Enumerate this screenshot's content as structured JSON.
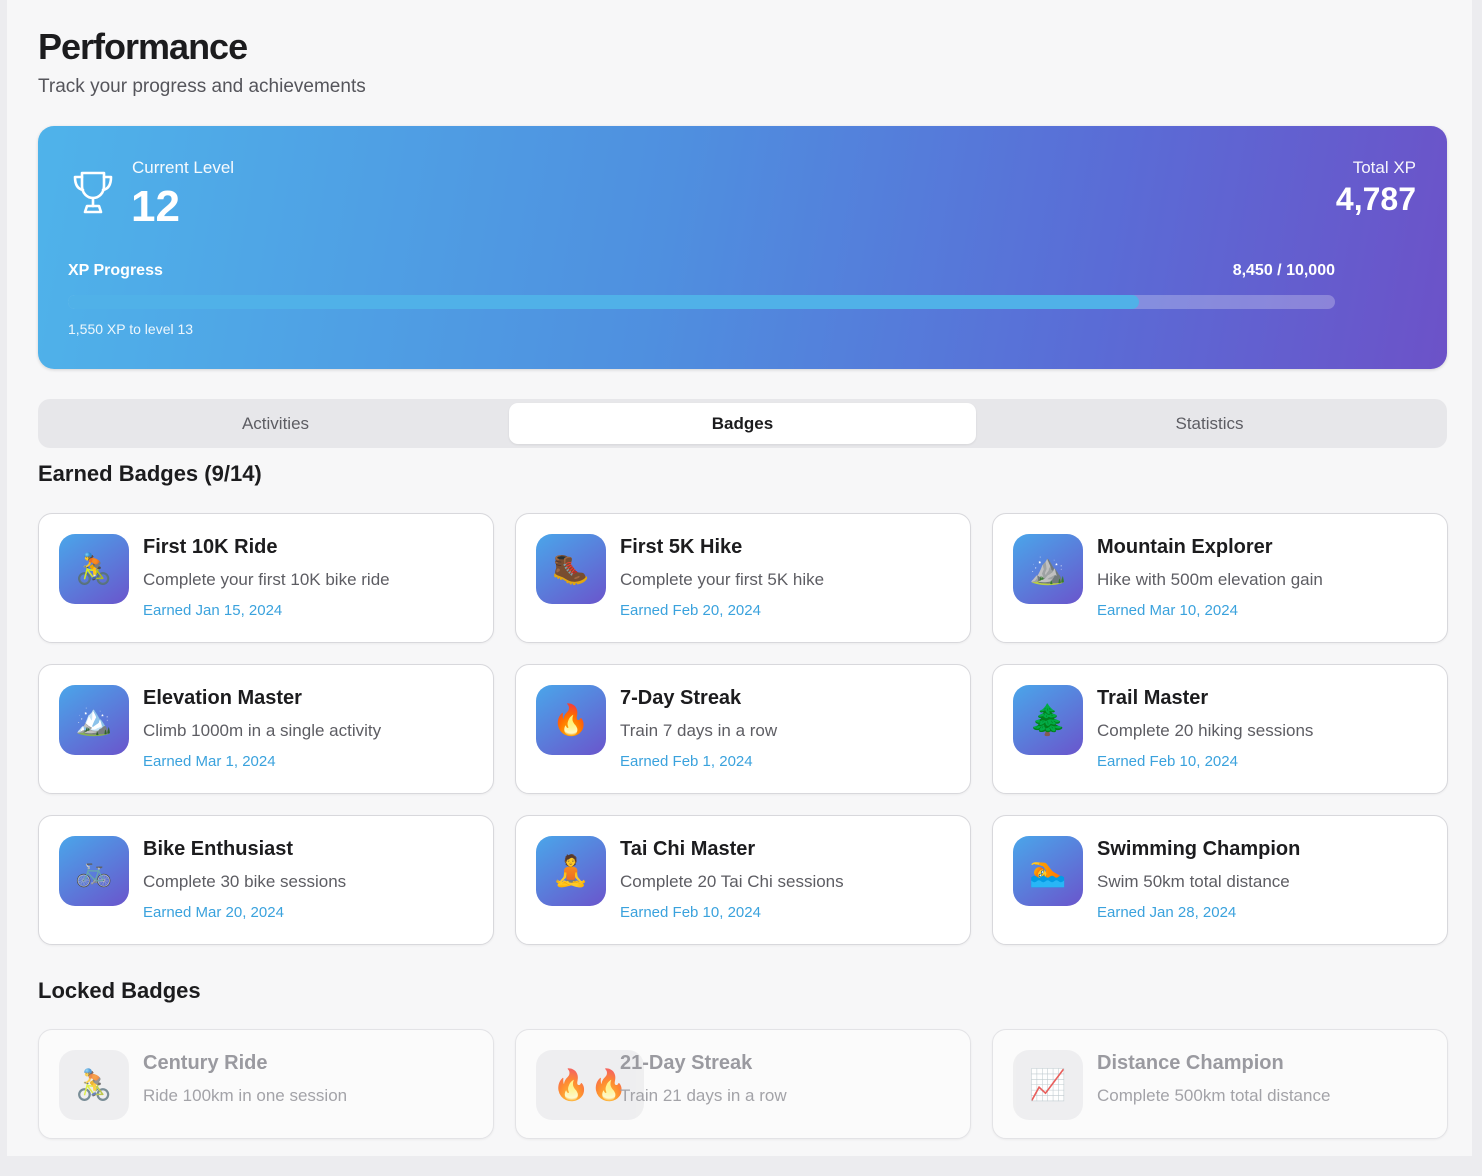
{
  "header": {
    "title": "Performance",
    "subtitle": "Track your progress and achievements"
  },
  "level_card": {
    "level_label": "Current Level",
    "level_value": "12",
    "xp_label": "Total XP",
    "xp_value": "4,787",
    "progress_label": "XP Progress",
    "progress_count": "8,450 / 10,000",
    "progress_fraction": 0.845,
    "progress_note": "1,550 XP to level 13",
    "icon": "trophy-icon"
  },
  "tabs": [
    {
      "label": "Activities",
      "active": false
    },
    {
      "label": "Badges",
      "active": true
    },
    {
      "label": "Statistics",
      "active": false
    }
  ],
  "earned": {
    "title": "Earned Badges (9/14)",
    "badges": [
      {
        "name": "First 10K Ride",
        "desc": "Complete your first 10K bike ride",
        "date": "Earned Jan 15, 2024",
        "icon": "🚴"
      },
      {
        "name": "First 5K Hike",
        "desc": "Complete your first 5K hike",
        "date": "Earned Feb 20, 2024",
        "icon": "🥾"
      },
      {
        "name": "Mountain Explorer",
        "desc": "Hike with 500m elevation gain",
        "date": "Earned Mar 10, 2024",
        "icon": "⛰️"
      },
      {
        "name": "Elevation Master",
        "desc": "Climb 1000m in a single activity",
        "date": "Earned Mar 1, 2024",
        "icon": "🏔️"
      },
      {
        "name": "7-Day Streak",
        "desc": "Train 7 days in a row",
        "date": "Earned Feb 1, 2024",
        "icon": "🔥"
      },
      {
        "name": "Trail Master",
        "desc": "Complete 20 hiking sessions",
        "date": "Earned Feb 10, 2024",
        "icon": "🌲"
      },
      {
        "name": "Bike Enthusiast",
        "desc": "Complete 30 bike sessions",
        "date": "Earned Mar 20, 2024",
        "icon": "🚲"
      },
      {
        "name": "Tai Chi Master",
        "desc": "Complete 20 Tai Chi sessions",
        "date": "Earned Feb 10, 2024",
        "icon": "🧘"
      },
      {
        "name": "Swimming Champion",
        "desc": "Swim 50km total distance",
        "date": "Earned Jan 28, 2024",
        "icon": "🏊"
      }
    ]
  },
  "locked": {
    "title": "Locked Badges",
    "badges": [
      {
        "name": "Century Ride",
        "desc": "Ride 100km in one session",
        "icon": "🚴"
      },
      {
        "name": "21-Day Streak",
        "desc": "Train 21 days in a row",
        "icon": "🔥🔥"
      },
      {
        "name": "Distance Champion",
        "desc": "Complete 500km total distance",
        "icon": "📈"
      }
    ]
  }
}
